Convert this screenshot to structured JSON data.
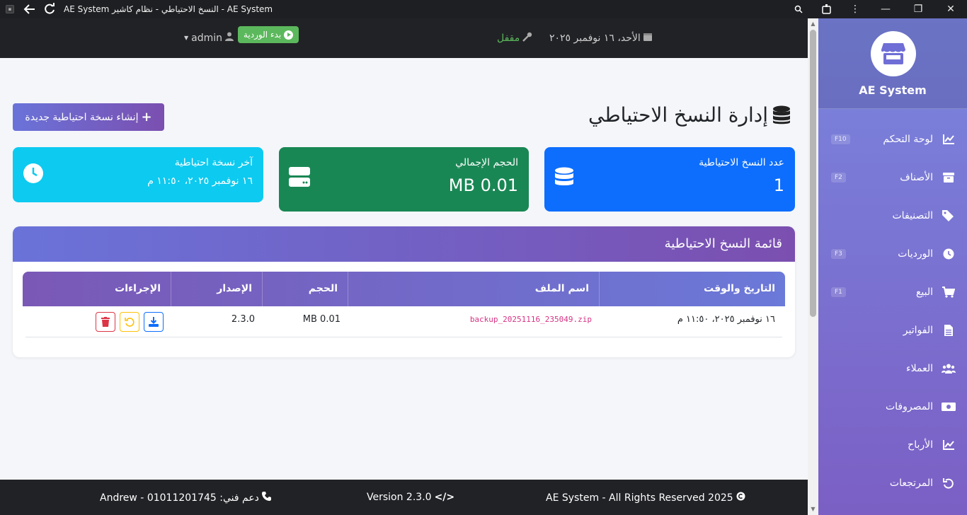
{
  "window": {
    "title": "AE System النسخ الاحتياطي - نظام كاشير - AE System"
  },
  "topbar": {
    "user": "admin",
    "shift_button": "بدء الوردية",
    "lock_status": "مقفل",
    "date": "الأحد، ١٦ نوفمبر ٢٠٢٥"
  },
  "page": {
    "title": "إدارة النسخ الاحتياطي",
    "create_button": "إنشاء نسخة احتياطية جديدة"
  },
  "cards": {
    "count": {
      "label": "عدد النسخ الاحتياطية",
      "value": "1"
    },
    "size": {
      "label": "الحجم الإجمالي",
      "value": "0.01 MB"
    },
    "last": {
      "label": "آخر نسخة احتياطية",
      "value": "١٦ نوفمبر ٢٠٢٥، ١١:٥٠ م"
    }
  },
  "backup_list": {
    "title": "قائمة النسخ الاحتياطية",
    "headers": [
      "التاريخ والوقت",
      "اسم الملف",
      "الحجم",
      "الإصدار",
      "الإجراءات"
    ],
    "rows": [
      {
        "date": "١٦ نوفمبر ٢٠٢٥، ١١:٥٠ م",
        "file": "backup_20251116_235049.zip",
        "size": "0.01 MB",
        "version": "2.3.0"
      }
    ]
  },
  "footer": {
    "copyright": "AE System - All Rights Reserved 2025",
    "version": "Version 2.3.0",
    "support": "دعم فني: 01011201745 - Andrew"
  },
  "sidebar": {
    "brand": "AE System",
    "items": [
      {
        "label": "لوحة التحكم",
        "shortcut": "F10",
        "icon": "chart-line-icon"
      },
      {
        "label": "الأصناف",
        "shortcut": "F2",
        "icon": "box-icon"
      },
      {
        "label": "التصنيفات",
        "shortcut": "",
        "icon": "tags-icon"
      },
      {
        "label": "الورديات",
        "shortcut": "F3",
        "icon": "clock-icon"
      },
      {
        "label": "البيع",
        "shortcut": "F1",
        "icon": "cart-icon"
      },
      {
        "label": "الفواتير",
        "shortcut": "",
        "icon": "invoice-icon"
      },
      {
        "label": "العملاء",
        "shortcut": "",
        "icon": "users-icon"
      },
      {
        "label": "المصروفات",
        "shortcut": "",
        "icon": "money-icon"
      },
      {
        "label": "الأرباح",
        "shortcut": "",
        "icon": "chart-line-icon"
      },
      {
        "label": "المرتجعات",
        "shortcut": "",
        "icon": "undo-icon"
      }
    ]
  }
}
